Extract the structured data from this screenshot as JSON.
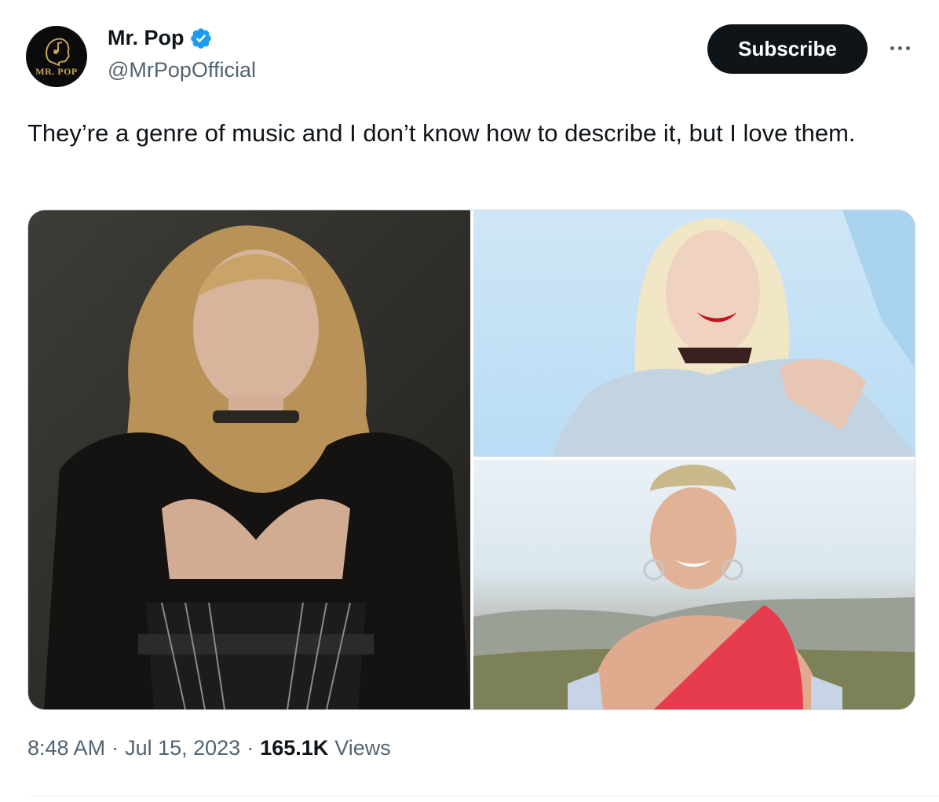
{
  "author": {
    "name": "Mr. Pop",
    "handle": "@MrPopOfficial",
    "avatar_text": "MR. POP",
    "verified": true
  },
  "actions": {
    "subscribe_label": "Subscribe",
    "more_icon": "ellipsis-icon"
  },
  "tweet": {
    "text": "They’re a genre of music and I don’t know how to describe it, but I love them."
  },
  "media": {
    "count": 3
  },
  "meta": {
    "time": "8:48 AM",
    "separator": "·",
    "date": "Jul 15, 2023",
    "views_count": "165.1K",
    "views_label": "Views"
  },
  "colors": {
    "text_primary": "#0f1419",
    "text_secondary": "#536471",
    "verified_blue": "#1d9bf0",
    "button_bg": "#0f1419"
  }
}
